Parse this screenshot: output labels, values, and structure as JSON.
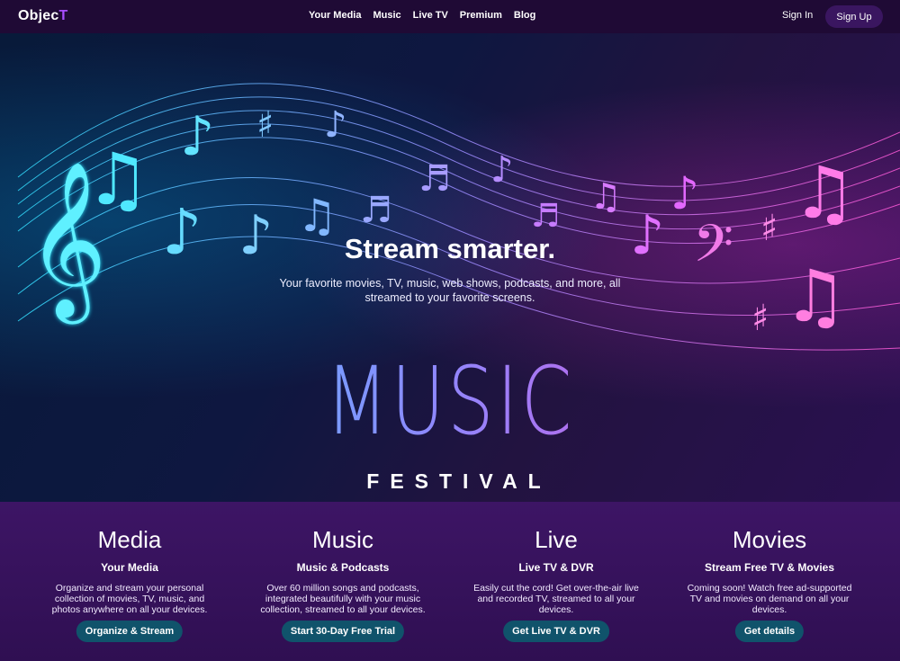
{
  "brand": {
    "name_main": "Objec",
    "name_accent": "T"
  },
  "nav": {
    "links": [
      "Your Media",
      "Music",
      "Live TV",
      "Premium",
      "Blog"
    ],
    "signin": "Sign In",
    "signup": "Sign Up"
  },
  "hero": {
    "title": "Stream smarter.",
    "subtitle": "Your favorite movies, TV, music, web shows, podcasts, and more, all streamed to your favorite screens.",
    "music_word": "MUSIC",
    "festival_word": "FESTIVAL"
  },
  "features": [
    {
      "title": "Media",
      "subtitle": "Your Media",
      "text": "Organize and stream your personal collection of movies, TV, music, and photos anywhere on all your devices.",
      "button": "Organize & Stream"
    },
    {
      "title": "Music",
      "subtitle": "Music & Podcasts",
      "text": "Over 60 million songs and podcasts, integrated beautifully with your music collection, streamed to all your devices.",
      "button": "Start 30-Day Free Trial"
    },
    {
      "title": "Live",
      "subtitle": "Live TV & DVR",
      "text": "Easily cut the cord! Get over-the-air live and recorded TV, streamed to all your devices.",
      "button": "Get Live TV & DVR"
    },
    {
      "title": "Movies",
      "subtitle": "Stream Free TV & Movies",
      "text": "Coming soon! Watch free ad-supported TV and movies on demand on all your devices.",
      "button": "Get details"
    }
  ],
  "colors": {
    "accent": "#a64dff",
    "button": "#10536b",
    "nav_bg": "#1f0a35",
    "features_bg": "#3d1565"
  }
}
